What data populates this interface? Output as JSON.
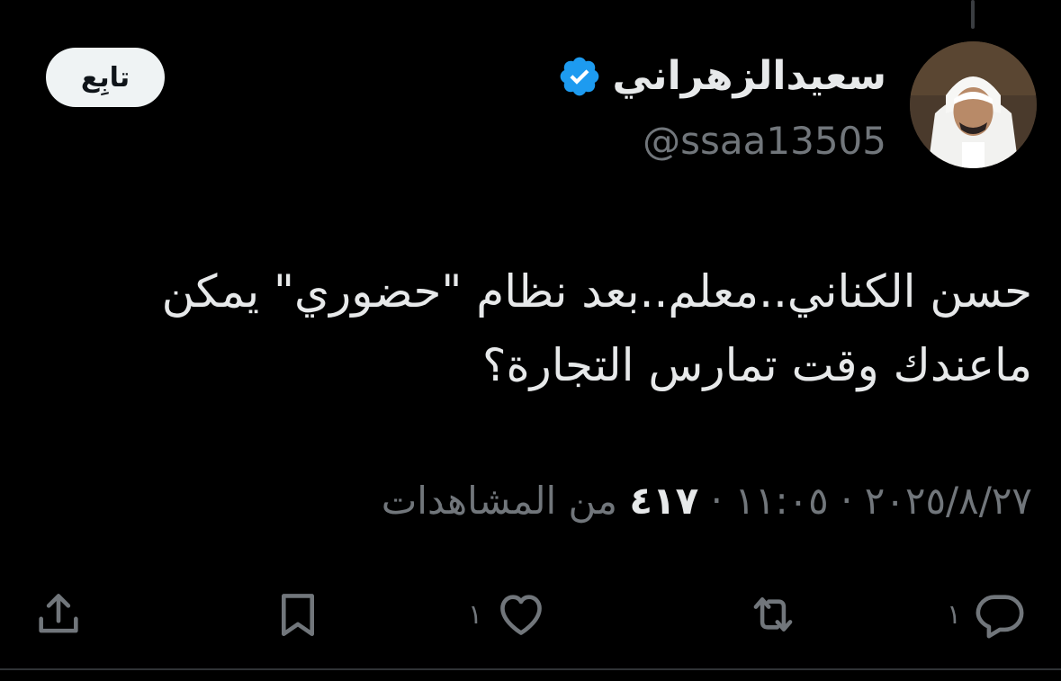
{
  "author": {
    "display_name": "سعيدالزهراني",
    "handle": "@ssaa13505",
    "verified": true
  },
  "follow_button": {
    "label": "تابِع"
  },
  "tweet": {
    "line1": "حسن الكناني..معلم..بعد نظام \"حضوري\" يمكن",
    "line2": "ماعندك وقت تمارس التجارة؟"
  },
  "meta": {
    "date": "٢٠٢٥/٨/٢٧",
    "separator": " · ",
    "time": "١١:٠٥",
    "views_count": "٤١٧",
    "views_label": " من المشاهدات"
  },
  "actions": {
    "reply_count": "١",
    "like_count": "١"
  },
  "colors": {
    "background": "#000000",
    "text_primary": "#e7e9ea",
    "text_secondary": "#71767b",
    "verified_badge": "#1d9bf0",
    "follow_bg": "#eff3f4"
  },
  "icons": {
    "verified": "verified-badge-icon",
    "reply": "reply-icon",
    "retweet": "retweet-icon",
    "like": "heart-icon",
    "bookmark": "bookmark-icon",
    "share": "share-icon"
  }
}
